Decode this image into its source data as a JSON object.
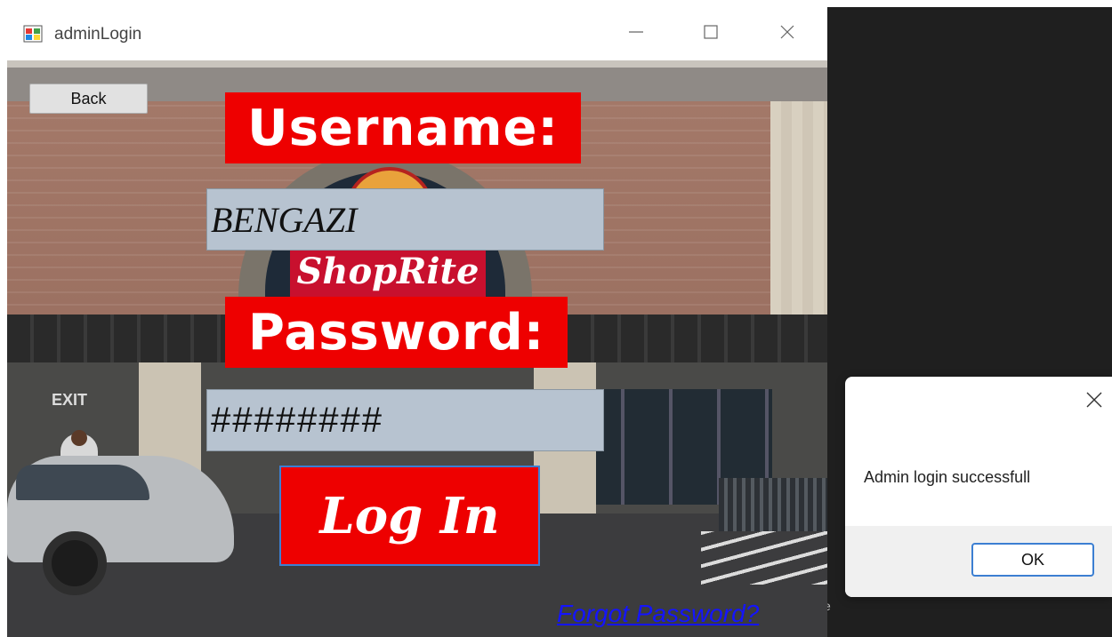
{
  "window": {
    "title": "adminLogin",
    "icon": "app-window-icon",
    "controls": {
      "minimize": "minimize-icon",
      "maximize": "maximize-icon",
      "close": "close-icon"
    }
  },
  "form": {
    "back_label": "Back",
    "username_label": "Username:",
    "username_value": "BENGAZI",
    "password_label": "Password:",
    "password_value": "########",
    "login_label": "Log In",
    "forgot_label": "Forgot Password?",
    "background_sign": "ShopRite",
    "exit_sign": "EXIT"
  },
  "dialog": {
    "message": "Admin login successfull",
    "ok_label": "OK",
    "close_icon": "close-icon"
  },
  "desktop": {
    "glyph": "e"
  },
  "colors": {
    "label_red": "#ee0000",
    "field_bg": "#b7c3d0",
    "link_blue": "#1414ff",
    "focus_border": "#3c7fd2"
  }
}
